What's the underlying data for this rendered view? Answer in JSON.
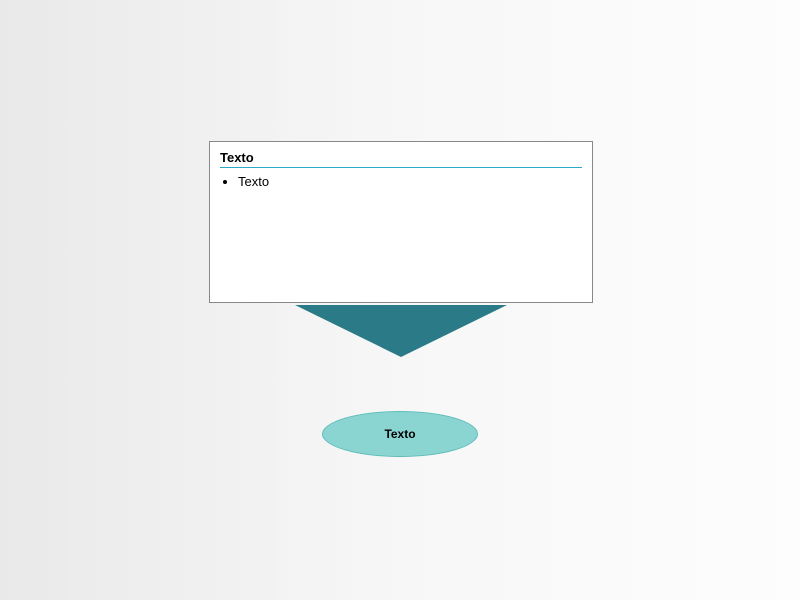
{
  "box": {
    "title": "Texto",
    "items": [
      "Texto"
    ]
  },
  "ellipse": {
    "label": "Texto"
  },
  "colors": {
    "rule": "#2aa9c9",
    "arrow": "#2a7a87",
    "ellipseFill": "#8ad4d1",
    "ellipseStroke": "#5fbdb9"
  }
}
